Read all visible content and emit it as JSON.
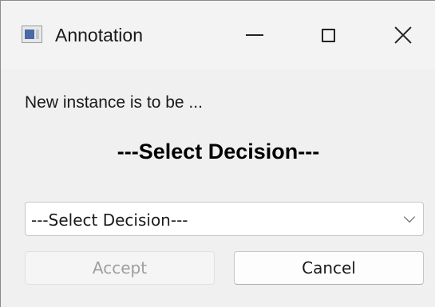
{
  "window": {
    "title": "Annotation",
    "icon": "app-window-icon",
    "controls": [
      "minimize-icon",
      "maximize-icon",
      "close-icon"
    ]
  },
  "dialog": {
    "message": "New instance is to be ...",
    "heading": "---Select Decision---",
    "decision_select": {
      "selected": "---Select Decision---"
    },
    "buttons": {
      "accept_label": "Accept",
      "accept_enabled": false,
      "cancel_label": "Cancel"
    }
  },
  "colors": {
    "background": "#f0f0f0",
    "disabled_text": "#9e9e9e"
  }
}
